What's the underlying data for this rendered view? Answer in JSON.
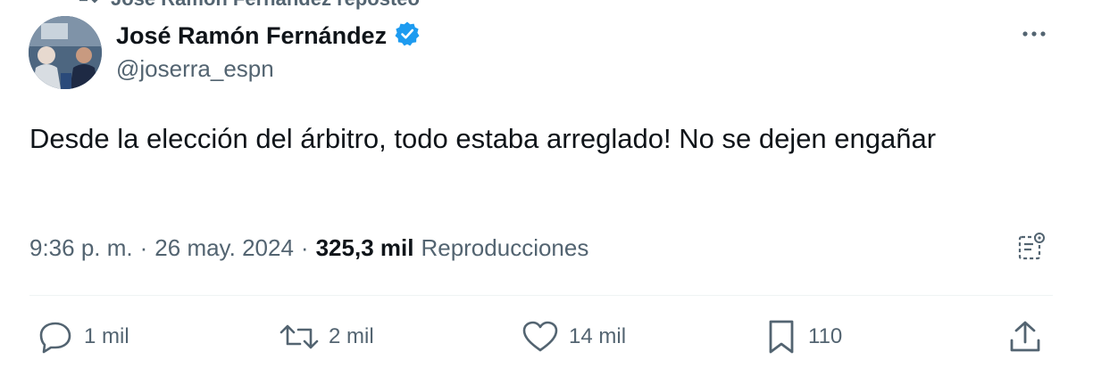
{
  "repost": {
    "label": "José Ramón Fernández reposteó",
    "icon": "repost-icon"
  },
  "author": {
    "display_name": "José Ramón Fernández",
    "handle": "@joserra_espn",
    "verified_icon": "verified-badge-icon",
    "avatar": "avatar-photo"
  },
  "more_icon": "more-options-icon",
  "tweet": {
    "text": "Desde la elección del árbitro, todo estaba arreglado! No se dejen engañar"
  },
  "meta": {
    "time": "9:36 p. m.",
    "separator": "·",
    "date": "26 may. 2024",
    "views_count": "325,3 mil",
    "views_label": "Reproducciones"
  },
  "actions": {
    "reply": {
      "icon": "reply-icon",
      "count": "1 mil"
    },
    "retweet": {
      "icon": "retweet-icon",
      "count": "2 mil"
    },
    "like": {
      "icon": "heart-icon",
      "count": "14 mil"
    },
    "bookmark": {
      "icon": "bookmark-icon",
      "count": "110"
    },
    "share": {
      "icon": "share-icon"
    }
  },
  "colors": {
    "verified_blue": "#1d9bf0",
    "secondary_text": "#536471",
    "primary_text": "#0f1419"
  }
}
